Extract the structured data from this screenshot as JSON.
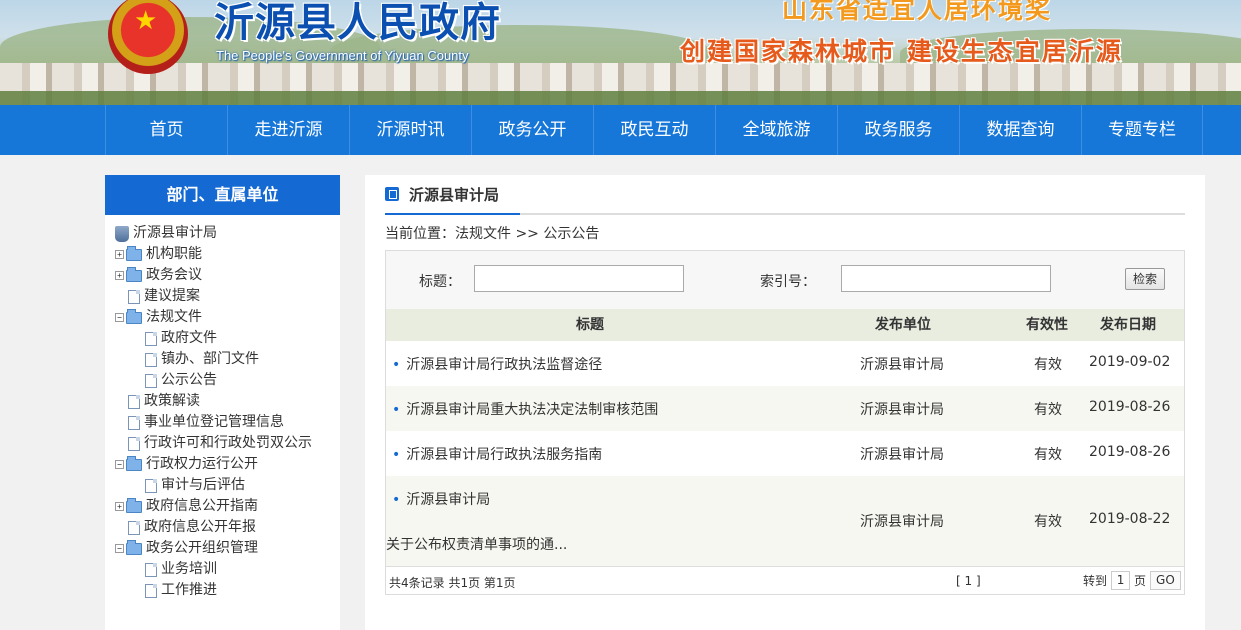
{
  "header": {
    "title": "沂源县人民政府",
    "subtitle": "The People's Government of Yiyuan County",
    "slogan1": "山东省适宜人居环境奖",
    "slogan2": "创建国家森林城市 建设生态宜居沂源"
  },
  "nav": [
    "首页",
    "走进沂源",
    "沂源时讯",
    "政务公开",
    "政民互动",
    "全域旅游",
    "政务服务",
    "数据查询",
    "专题专栏"
  ],
  "sidebar": {
    "heading": "部门、直属单位",
    "root": "沂源县审计局",
    "items": [
      {
        "label": "机构职能"
      },
      {
        "label": "政务会议"
      },
      {
        "label": "建议提案"
      },
      {
        "label": "法规文件"
      },
      {
        "label": "政府文件"
      },
      {
        "label": "镇办、部门文件"
      },
      {
        "label": "公示公告"
      },
      {
        "label": "政策解读"
      },
      {
        "label": "事业单位登记管理信息"
      },
      {
        "label": "行政许可和行政处罚双公示"
      },
      {
        "label": "行政权力运行公开"
      },
      {
        "label": "审计与后评估"
      },
      {
        "label": "政府信息公开指南"
      },
      {
        "label": "政府信息公开年报"
      },
      {
        "label": "政务公开组织管理"
      },
      {
        "label": "业务培训"
      },
      {
        "label": "工作推进"
      }
    ]
  },
  "main": {
    "tab_title": "沂源县审计局",
    "breadcrumb": "当前位置：法规文件 >> 公示公告",
    "search": {
      "title_label": "标题：",
      "index_label": "索引号：",
      "button": "检索"
    },
    "table": {
      "headers": [
        "标题",
        "发布单位",
        "有效性",
        "发布日期"
      ],
      "rows": [
        {
          "title": "沂源县审计局行政执法监督途径",
          "unit": "沂源县审计局",
          "valid": "有效",
          "date": "2019-09-02"
        },
        {
          "title": "沂源县审计局重大执法决定法制审核范围",
          "unit": "沂源县审计局",
          "valid": "有效",
          "date": "2019-08-26"
        },
        {
          "title": "沂源县审计局行政执法服务指南",
          "unit": "沂源县审计局",
          "valid": "有效",
          "date": "2019-08-26"
        },
        {
          "title": "沂源县审计局",
          "title2": "关于公布权责清单事项的通...",
          "unit": "沂源县审计局",
          "valid": "有效",
          "date": "2019-08-22"
        }
      ]
    },
    "pager": {
      "info": "共4条记录  共1页  第1页",
      "pages": "[ 1 ]",
      "jump_label": "转到",
      "page_value": "1",
      "page_suffix": "页",
      "go": "GO"
    }
  }
}
